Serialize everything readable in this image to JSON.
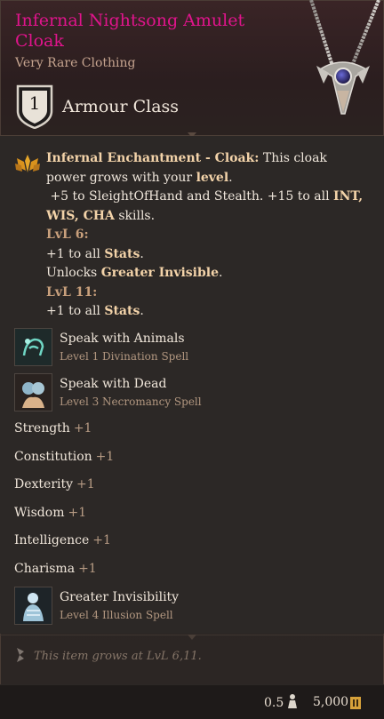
{
  "item": {
    "title": "Infernal Nightsong Amulet Cloak",
    "rarity_type": "Very Rare Clothing",
    "armour_class_value": "1",
    "armour_class_label": "Armour Class",
    "title_color": "#e0148c"
  },
  "enchantment": {
    "name": "Infernal Enchantment - Cloak:",
    "line1": " This cloak power grows with your ",
    "line1_bold": "level",
    "line1_end": ".",
    "line2": "+5 to SleightOfHand and Stealth. +15 to all ",
    "line2_bold": "INT, WIS, CHA",
    "line2_end": " skills.",
    "lvl6_label": "LvL 6:",
    "lvl6_a": "+1 to all ",
    "lvl6_a_bold": "Stats",
    "lvl6_a_end": ".",
    "lvl6_b": "Unlocks ",
    "lvl6_b_bold": "Greater Invisible",
    "lvl6_b_end": ".",
    "lvl11_label": "LvL 11:",
    "lvl11_a": "+1 to all ",
    "lvl11_a_bold": "Stats",
    "lvl11_a_end": "."
  },
  "spells": [
    {
      "name": "Speak with Animals",
      "sub": "Level 1 Divination Spell",
      "icon": "speak-animals-icon"
    },
    {
      "name": "Speak with Dead",
      "sub": "Level 3 Necromancy Spell",
      "icon": "speak-dead-icon"
    },
    {
      "name": "Greater Invisibility",
      "sub": "Level 4 Illusion Spell",
      "icon": "greater-invisibility-icon"
    }
  ],
  "stats": [
    {
      "name": "Strength",
      "value": "+1"
    },
    {
      "name": "Constitution",
      "value": "+1"
    },
    {
      "name": "Dexterity",
      "value": "+1"
    },
    {
      "name": "Wisdom",
      "value": "+1"
    },
    {
      "name": "Intelligence",
      "value": "+1"
    },
    {
      "name": "Charisma",
      "value": "+1"
    }
  ],
  "footer": {
    "note": "This item grows at LvL 6,11.",
    "weight": "0.5",
    "price": "5,000"
  }
}
